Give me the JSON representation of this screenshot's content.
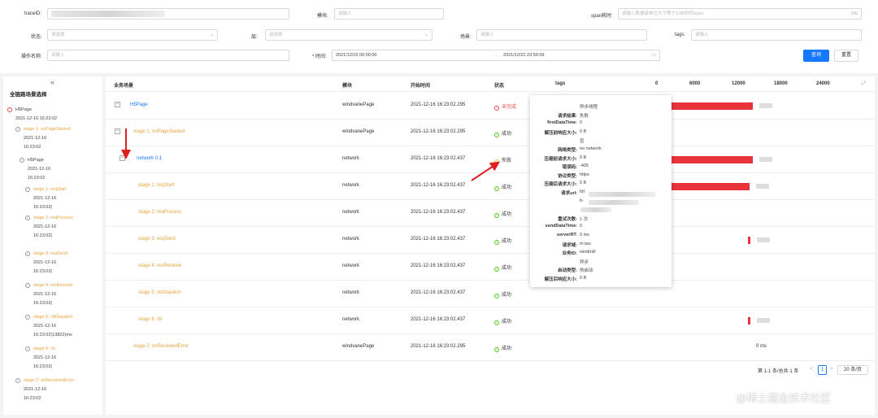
{
  "filters": {
    "trace_id_label": "traceID:",
    "module_label": "模块:",
    "module_placeholder": "请输入",
    "span_label": "span耗时:",
    "span_placeholder": "请输入数量级单位大于等于10标秒的span",
    "span_unit": "ms",
    "status_label": "状态:",
    "status_placeholder": "请选择",
    "layer_label": "层:",
    "layer_placeholder": "请选择",
    "scene_label": "场景:",
    "scene_placeholder": "请输入",
    "tags_label": "tags:",
    "tags_placeholder": "请输入",
    "op_label": "操作名称:",
    "op_placeholder": "请输入",
    "time_label": "* 时间:",
    "time_start": "2021/12/15 00:00:00",
    "time_arrow": "→",
    "time_end": "2021/12/22 23:59:59",
    "query_button": "查询",
    "reset_button": "重置"
  },
  "sidebar": {
    "collapse": "«",
    "title": "全链路场景选择",
    "nodes": [
      {
        "label": "H5Page",
        "color": "gray"
      },
      {
        "label": "2021-12-16 16:23:02",
        "color": "gray"
      },
      {
        "label": "stage 1: onPageStarted",
        "color": "orange"
      },
      {
        "label": "2021-12-16",
        "color": "gray"
      },
      {
        "label": "16:23:02",
        "color": "gray"
      },
      {
        "label": "H5Page",
        "color": "gray"
      },
      {
        "label": "2021-12-16",
        "color": "gray"
      },
      {
        "label": "16:23:02",
        "color": "gray"
      },
      {
        "label": "stage 1: reqStart",
        "color": "orange"
      },
      {
        "label": "2021-12-16",
        "color": "gray"
      },
      {
        "label": "16:23:02(",
        "color": "gray"
      },
      {
        "label": "stage 2: reqProcess",
        "color": "orange"
      },
      {
        "label": "2021-12-16",
        "color": "gray"
      },
      {
        "label": "16:23:02(",
        "color": "gray"
      },
      {
        "label": "stage 3: reqSend",
        "color": "orange"
      },
      {
        "label": "2021-12-16",
        "color": "gray"
      },
      {
        "label": "16:23:02(",
        "color": "gray"
      },
      {
        "label": "stage 4: resReceive",
        "color": "orange"
      },
      {
        "label": "2021-12-16",
        "color": "gray"
      },
      {
        "label": "16:23:02(",
        "color": "gray"
      },
      {
        "label": "stage 5: cbDispatch",
        "color": "orange"
      },
      {
        "label": "2021-12-16",
        "color": "gray"
      },
      {
        "label": "16:23:02(13822)ms",
        "color": "gray"
      },
      {
        "label": "stage 6: cb",
        "color": "orange"
      },
      {
        "label": "2021-12-16",
        "color": "gray"
      },
      {
        "label": "16:23:02(",
        "color": "gray"
      },
      {
        "label": "stage 2: onReceivedError",
        "color": "orange"
      },
      {
        "label": "2021-12-16",
        "color": "gray"
      },
      {
        "label": "16:23:02",
        "color": "gray"
      }
    ]
  },
  "table": {
    "headers": {
      "scene": "业务场景",
      "module": "模块",
      "start": "开始时间",
      "status": "状态",
      "tags": "tags"
    },
    "axis": [
      "0",
      "6000",
      "12000",
      "18000",
      "24000"
    ],
    "rows": [
      {
        "name": "H5Page",
        "module": "windvanePage",
        "start": "2021-12-16 16:23:02.295",
        "status": "未完成",
        "st": "pending",
        "bar_start": 0,
        "bar_ms": 13900,
        "color": "blue"
      },
      {
        "name": "stage 1: onPageStarted",
        "module": "windvanePage",
        "start": "2021-12-16 16:23:02.295",
        "status": "成功",
        "st": "ok",
        "bar_start": 0,
        "bar_ms": 0,
        "color": "orange"
      },
      {
        "name": "network 0.1",
        "module": "network",
        "start": "2021-12-16 16:23:02.437",
        "status": "失败",
        "st": "fail",
        "bar_start": 0,
        "bar_ms": 13900,
        "color": "blue"
      },
      {
        "name": "stage 1: reqStart",
        "module": "network",
        "start": "2021-12-16 16:23:02.437",
        "status": "成功",
        "st": "ok",
        "bar_start": 0,
        "bar_ms": 13400,
        "color": "orange"
      },
      {
        "name": "stage 2: reqProcess",
        "module": "network",
        "start": "2021-12-16 16:23:02.437",
        "status": "成功",
        "st": "ok",
        "bar_start": 0,
        "bar_ms": 0,
        "color": "orange"
      },
      {
        "name": "stage 3: reqSend",
        "module": "network",
        "start": "2021-12-16 16:23:02.437",
        "status": "成功",
        "st": "ok",
        "bar_start": 13100,
        "bar_ms": 400,
        "color": "orange"
      },
      {
        "name": "stage 4: resReceive",
        "module": "network",
        "start": "2021-12-16 16:23:02.437",
        "status": "成功",
        "st": "ok",
        "bar_start": 0,
        "bar_ms": 0,
        "color": "orange"
      },
      {
        "name": "stage 5: cbDispatch",
        "module": "network",
        "start": "2021-12-16 16:23:02.437",
        "status": "成功",
        "st": "ok",
        "bar_start": 0,
        "bar_ms": 0,
        "color": "orange"
      },
      {
        "name": "stage 6: cb",
        "module": "network",
        "start": "2021-12-16 16:23:02.437",
        "status": "成功",
        "st": "ok",
        "bar_start": 13100,
        "bar_ms": 400,
        "color": "orange"
      },
      {
        "name": "stage 2: onReceivedError",
        "module": "windvanePage",
        "start": "2021-12-16 16:23:02.295",
        "status": "成功",
        "st": "ok",
        "bar_start": 0,
        "bar_ms": 0,
        "color": "orange",
        "ms_label": "0 ms"
      }
    ]
  },
  "tooltip": {
    "rows": [
      {
        "k": "",
        "v": "异步线程"
      },
      {
        "k": "请求结果:",
        "v": "失败"
      },
      {
        "k": "firstDataTime:",
        "v": "0"
      },
      {
        "k": "解压前响应大小:",
        "v": "0  B"
      },
      {
        "k": "",
        "v": "否"
      },
      {
        "k": "网络类型:",
        "v": "no network"
      },
      {
        "k": "压缩前请求大小:",
        "v": "0  B"
      },
      {
        "k": "错误码:",
        "v": "-405"
      },
      {
        "k": "协议类型:",
        "v": "https"
      },
      {
        "k": "压缩后请求大小:",
        "v": "0  B"
      },
      {
        "k": "请求url:",
        "v": "htt"
      },
      {
        "k": "",
        "v": "b-"
      },
      {
        "k": "",
        "v": ""
      },
      {
        "k": "重试次数:",
        "v": "1  次"
      },
      {
        "k": "sendDataTime:",
        "v": "0"
      },
      {
        "k": "serverRT:",
        "v": "0  ms"
      },
      {
        "k": "请求域:",
        "v": "m.tao"
      },
      {
        "k": "业务ID:",
        "v": "windmill"
      },
      {
        "k": "",
        "v": "异步"
      },
      {
        "k": "启动类型:",
        "v": "热启动"
      },
      {
        "k": "解压后响应大小:",
        "v": "0  B"
      }
    ]
  },
  "pagination": {
    "summary": "第 1-1 条/总共 1 条",
    "prev": "<",
    "page": "1",
    "next": ">",
    "size": "20 条/页"
  },
  "watermark": "@稀土掘金技术社区"
}
